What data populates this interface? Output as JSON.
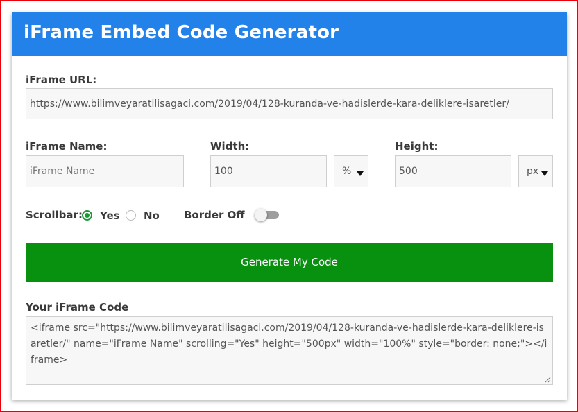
{
  "header": {
    "title": "iFrame Embed Code Generator"
  },
  "url": {
    "label": "iFrame URL:",
    "value": "https://www.bilimveyaratilisagaci.com/2019/04/128-kuranda-ve-hadislerde-kara-deliklere-isaretler/"
  },
  "name": {
    "label": "iFrame Name:",
    "placeholder": "iFrame Name"
  },
  "width": {
    "label": "Width:",
    "value": "100",
    "unit": "%"
  },
  "height": {
    "label": "Height:",
    "value": "500",
    "unit": "px"
  },
  "scrollbar": {
    "label": "Scrollbar:",
    "options": [
      "Yes",
      "No"
    ],
    "selected": "Yes"
  },
  "border": {
    "label": "Border Off",
    "toggle_on": false
  },
  "generate_button": {
    "label": "Generate My Code"
  },
  "output": {
    "label": "Your iFrame Code",
    "code": "<iframe src=\"https://www.bilimveyaratilisagaci.com/2019/04/128-kuranda-ve-hadislerde-kara-deliklere-isaretler/\" name=\"iFrame Name\" scrolling=\"Yes\" height=\"500px\" width=\"100%\" style=\"border: none;\"></iframe>"
  },
  "colors": {
    "header": "#2382ea",
    "button": "#08900f",
    "radio_checked": "#1a9a35",
    "frame_border": "#e8000b"
  }
}
